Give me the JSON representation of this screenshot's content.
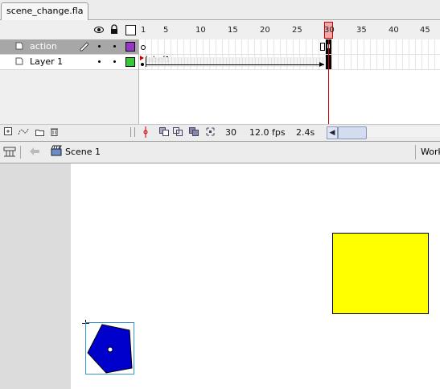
{
  "document": {
    "tab_title": "scene_change.fla"
  },
  "timeline": {
    "frame_ruler": [
      "1",
      "5",
      "10",
      "15",
      "20",
      "25",
      "30",
      "35",
      "40",
      "45"
    ],
    "layers": [
      {
        "name": "action",
        "color": "#9933cc",
        "selected": true
      },
      {
        "name": "Layer 1",
        "color": "#33cc33",
        "selected": false
      }
    ],
    "frame_label": "label1",
    "current_frame": "30",
    "frame_rate": "12.0 fps",
    "elapsed_time": "2.4s",
    "playhead_color": "#cc0000"
  },
  "edit_bar": {
    "scene_name": "Scene 1",
    "workspace_label": "Work"
  },
  "stage": {
    "rectangle_color": "#ffff00",
    "pentagon_color": "#0000cc"
  }
}
